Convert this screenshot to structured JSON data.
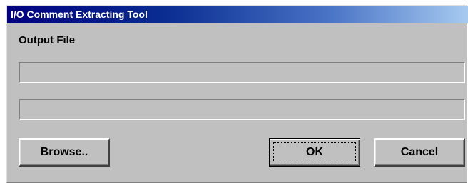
{
  "window": {
    "title": "I/O Comment Extracting Tool"
  },
  "form": {
    "output_label": "Output File",
    "field1_value": "",
    "field2_value": ""
  },
  "buttons": {
    "browse_label": "Browse..",
    "ok_label": "OK",
    "cancel_label": "Cancel"
  },
  "colors": {
    "title_start": "#000080",
    "title_end": "#a6caf0",
    "dialog_bg": "#c0c0c0"
  }
}
